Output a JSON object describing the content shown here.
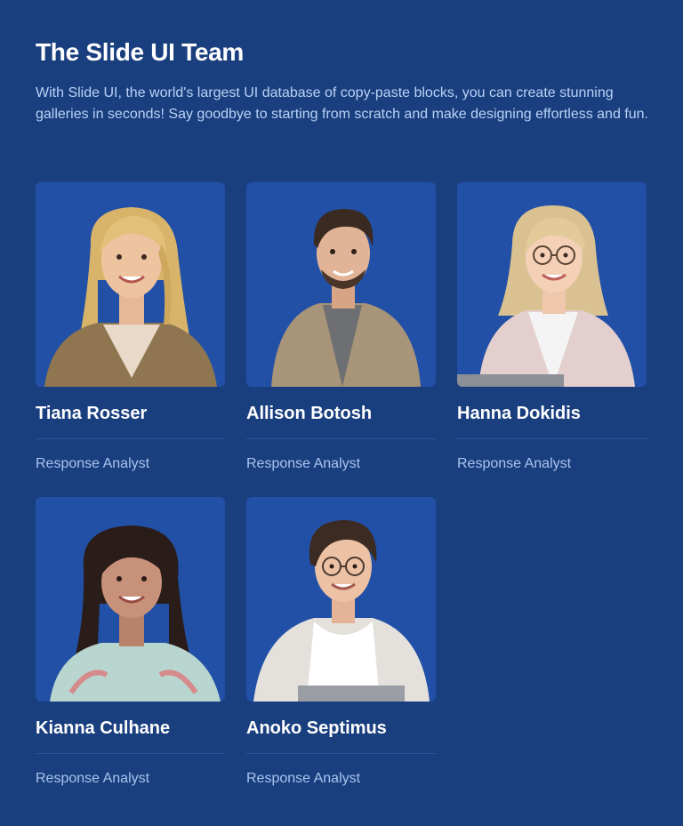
{
  "header": {
    "title": "The Slide UI Team",
    "description": "With Slide UI, the world's largest UI database of copy-paste blocks, you can create stunning galleries in seconds! Say goodbye to starting from scratch and make designing effortless and fun."
  },
  "colors": {
    "background": "#1a3f7f",
    "card_photo_bg": "#2150a6",
    "title": "#ffffff",
    "body_text": "#b9d2f5",
    "role_text": "#a9c4ee",
    "divider": "#2c539a"
  },
  "team": [
    {
      "name": "Tiana Rosser",
      "role": "Response Analyst"
    },
    {
      "name": "Allison Botosh",
      "role": "Response Analyst"
    },
    {
      "name": "Hanna Dokidis",
      "role": "Response Analyst"
    },
    {
      "name": "Kianna Culhane",
      "role": "Response Analyst"
    },
    {
      "name": "Anoko Septimus",
      "role": "Response Analyst"
    }
  ]
}
